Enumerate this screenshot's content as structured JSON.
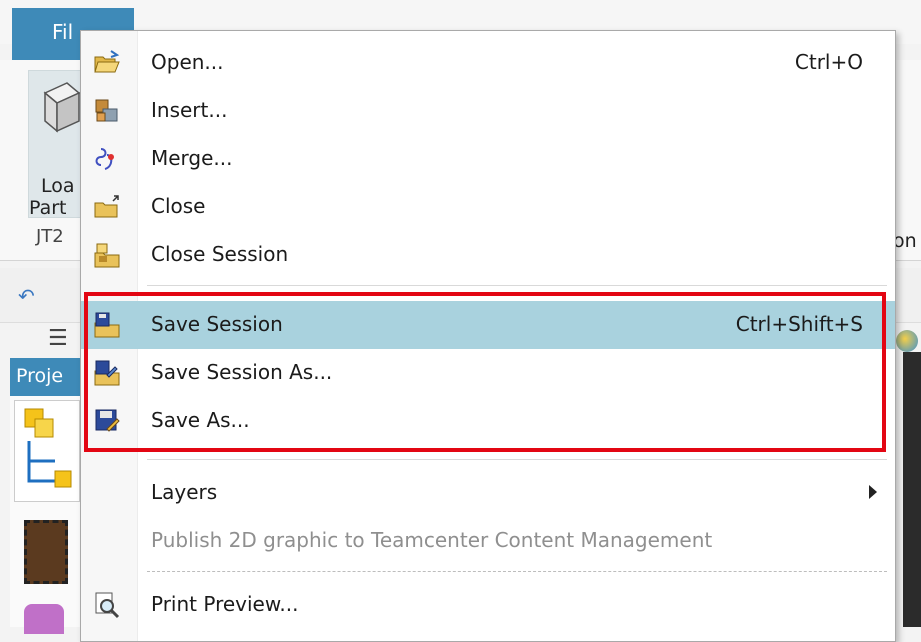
{
  "app": {
    "file_tab": "Fil",
    "load_line1": "Loa",
    "load_line2": "Part",
    "group_label": "JT2",
    "ribbon_right": "on",
    "panel_title": "Proje"
  },
  "menu": {
    "open": {
      "label": "Open...",
      "shortcut": "Ctrl+O"
    },
    "insert": {
      "label": "Insert..."
    },
    "merge": {
      "label": "Merge..."
    },
    "close": {
      "label": "Close"
    },
    "close_session": {
      "label": "Close Session"
    },
    "save_session": {
      "label": "Save Session",
      "shortcut": "Ctrl+Shift+S"
    },
    "save_session_as": {
      "label": "Save Session As..."
    },
    "save_as": {
      "label": "Save As..."
    },
    "layers": {
      "label": "Layers"
    },
    "publish": {
      "label": "Publish 2D graphic to Teamcenter Content Management"
    },
    "print_preview": {
      "label": "Print Preview..."
    }
  },
  "colors": {
    "highlight": "#a9d2de",
    "accent_blue": "#3e8ab8",
    "annotation_red": "#e30613"
  },
  "icons": [
    "open-folder-icon",
    "insert-icon",
    "merge-icon",
    "close-folder-icon",
    "close-session-icon",
    "save-session-icon",
    "save-session-as-icon",
    "save-as-icon",
    "print-preview-icon",
    "submenu-arrow-icon"
  ]
}
